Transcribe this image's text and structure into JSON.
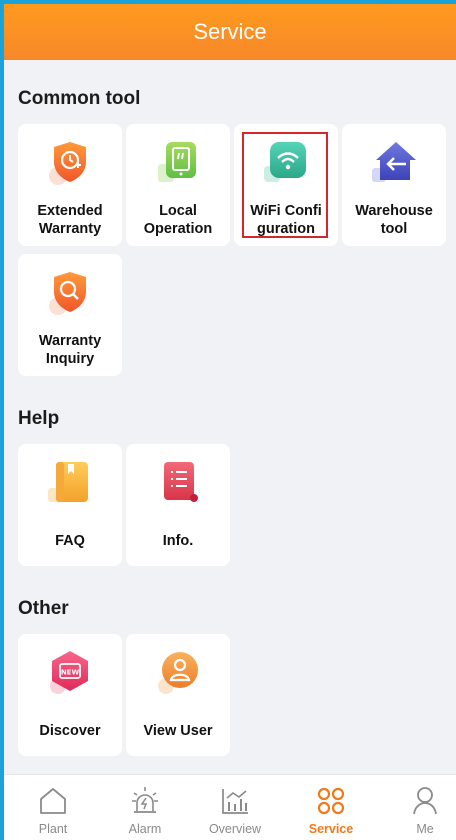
{
  "header": {
    "title": "Service"
  },
  "sections": {
    "common": {
      "title": "Common tool"
    },
    "help": {
      "title": "Help"
    },
    "other": {
      "title": "Other"
    }
  },
  "tools": {
    "extended_warranty": {
      "line1": "Extended",
      "line2": "Warranty",
      "icon": "shield-clock-icon"
    },
    "local_operation": {
      "line1": "Local",
      "line2": "Operation",
      "icon": "phone-icon"
    },
    "wifi_configuration": {
      "line1": "WiFi Confi",
      "line2": "guration",
      "icon": "wifi-icon"
    },
    "warehouse_tool": {
      "line1": "Warehouse",
      "line2": "tool",
      "icon": "warehouse-arrow-icon"
    },
    "warranty_inquiry": {
      "line1": "Warranty",
      "line2": "Inquiry",
      "icon": "shield-search-icon"
    }
  },
  "help": {
    "faq": {
      "label": "FAQ",
      "icon": "book-icon"
    },
    "info": {
      "label": "Info.",
      "icon": "document-icon"
    }
  },
  "other": {
    "discover": {
      "label": "Discover",
      "icon": "new-badge-icon"
    },
    "view_user": {
      "label": "View User",
      "icon": "user-icon"
    }
  },
  "tabbar": {
    "plant": "Plant",
    "alarm": "Alarm",
    "overview": "Overview",
    "service": "Service",
    "me": "Me",
    "active": "service"
  },
  "colors": {
    "header": "#f7882a",
    "active_tab": "#f07a1a",
    "selection_outline": "#d6252b",
    "frame_border": "#1aa3d8"
  }
}
